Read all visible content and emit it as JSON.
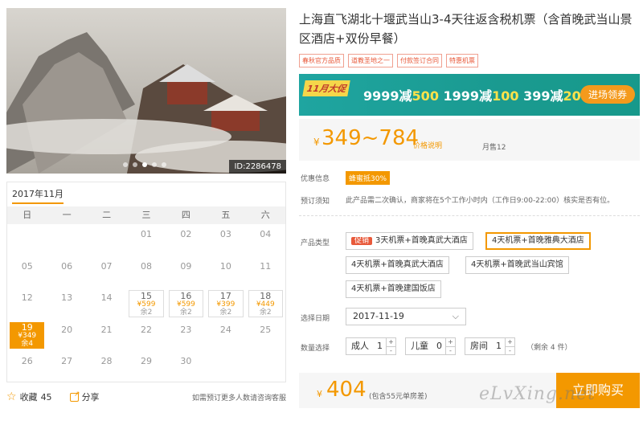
{
  "hero": {
    "image_id": "ID:2286478",
    "dots": 5,
    "active_dot": 2
  },
  "calendar": {
    "month": "2017年11月",
    "weekdays": [
      "日",
      "一",
      "二",
      "三",
      "四",
      "五",
      "六"
    ],
    "cells": [
      {
        "d": ""
      },
      {
        "d": ""
      },
      {
        "d": ""
      },
      {
        "d": "01"
      },
      {
        "d": "02"
      },
      {
        "d": "03"
      },
      {
        "d": "04"
      },
      {
        "d": "05"
      },
      {
        "d": "06"
      },
      {
        "d": "07"
      },
      {
        "d": "08"
      },
      {
        "d": "09"
      },
      {
        "d": "10"
      },
      {
        "d": "11"
      },
      {
        "d": "12"
      },
      {
        "d": "13"
      },
      {
        "d": "14"
      },
      {
        "d": "15",
        "p": "¥599",
        "r": "余2"
      },
      {
        "d": "16",
        "p": "¥599",
        "r": "余2"
      },
      {
        "d": "17",
        "p": "¥399",
        "r": "余2"
      },
      {
        "d": "18",
        "p": "¥449",
        "r": "余2"
      },
      {
        "d": "19",
        "p": "¥349",
        "r": "余4",
        "sel": true
      },
      {
        "d": "20"
      },
      {
        "d": "21"
      },
      {
        "d": "22"
      },
      {
        "d": "23"
      },
      {
        "d": "24"
      },
      {
        "d": "25"
      },
      {
        "d": "26"
      },
      {
        "d": "27"
      },
      {
        "d": "28"
      },
      {
        "d": "29"
      },
      {
        "d": "30"
      }
    ]
  },
  "bottombar": {
    "fav_label": "收藏",
    "fav_count": "45",
    "share_label": "分享",
    "note": "如需预订更多人数请咨询客服"
  },
  "product": {
    "title": "上海直飞湖北十堰武当山3-4天往返含税机票（含首晚武当山景区酒店+双份早餐）",
    "tags": [
      "春秋官方品质",
      "道教圣地之一",
      "付款签订合同",
      "特惠机票"
    ]
  },
  "banner": {
    "badge": "11月大促",
    "deals": [
      [
        "9999减",
        "500"
      ],
      [
        "1999减",
        "100"
      ],
      [
        "399减",
        "20"
      ]
    ],
    "cta": "进场领券"
  },
  "price": {
    "currency": "¥",
    "range": "349~784",
    "explain": "价格说明",
    "sold": "月售12"
  },
  "promo": {
    "label": "优惠信息",
    "value": "蜂蜜抵30%"
  },
  "notice": {
    "label": "预订须知",
    "text": "此产品需二次确认，商家将在5个工作小时内（工作日9:00-22:00）核实是否有位。"
  },
  "types": {
    "label": "产品类型",
    "hot": "促销",
    "options": [
      "3天机票+首晚真武大酒店",
      "4天机票+首晚雅典大酒店",
      "4天机票+首晚真武大酒店",
      "4天机票+首晚武当山宾馆",
      "4天机票+首晚建国饭店"
    ]
  },
  "date": {
    "label": "选择日期",
    "value": "2017-11-19"
  },
  "quantity": {
    "label": "数量选择",
    "adult": {
      "label": "成人",
      "value": "1"
    },
    "child": {
      "label": "儿童",
      "value": "0"
    },
    "room": {
      "label": "房间",
      "value": "1"
    },
    "remaining": "（剩余 4 件）"
  },
  "footer": {
    "currency": "¥",
    "amount": "404",
    "included": "(包含55元单房差)",
    "buy": "立即购买"
  },
  "watermark": "eLvXing.net",
  "colors": {
    "accent": "#f39800",
    "banner": "#1fa5a0",
    "tag": "#e8593a"
  }
}
